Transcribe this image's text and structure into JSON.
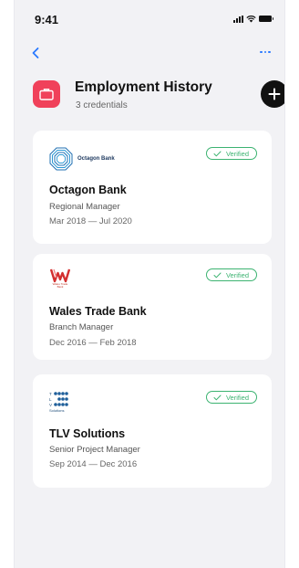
{
  "status_bar": {
    "time": "9:41"
  },
  "header": {
    "title": "Employment History",
    "subtitle": "3 credentials"
  },
  "credentials": [
    {
      "logo_text": "Octagon Bank",
      "logo_color": "#1f3a60",
      "badge": "Verified",
      "company": "Octagon Bank",
      "role": "Regional Manager",
      "dates": "Mar 2018 — Jul 2020"
    },
    {
      "logo_text": "Wales Trade Bank",
      "logo_color": "#c0392b",
      "badge": "Verified",
      "company": "Wales Trade Bank",
      "role": "Branch Manager",
      "dates": "Dec 2016 — Feb 2018"
    },
    {
      "logo_text": "Solutions",
      "logo_color": "#1f4e7a",
      "badge": "Verified",
      "company": "TLV Solutions",
      "role": "Senior Project Manager",
      "dates": "Sep 2014 — Dec 2016"
    }
  ],
  "colors": {
    "accent": "#2979ff",
    "verified": "#3cb371",
    "header_icon": "#f0415a"
  },
  "icons": {
    "back": "chevron-left-icon",
    "more": "more-horizontal-icon",
    "header": "briefcase-icon",
    "add": "plus-icon",
    "verified": "checkmark-icon"
  }
}
